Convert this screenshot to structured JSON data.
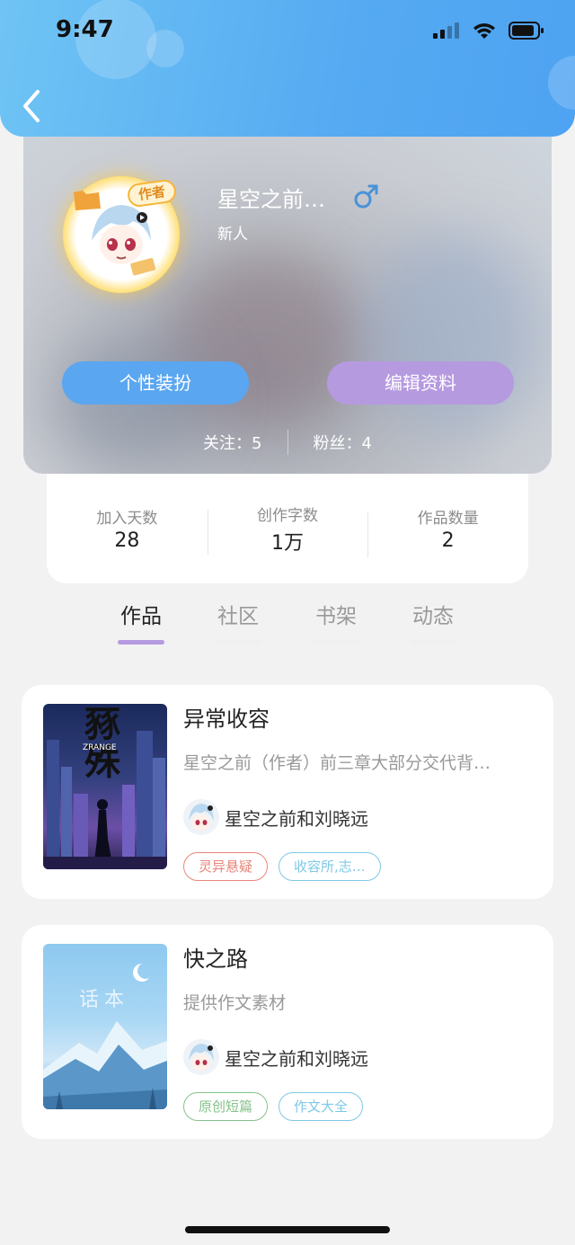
{
  "status_bar": {
    "time": "9:47"
  },
  "profile": {
    "nickname": "星空之前…",
    "level": "新人",
    "author_badge": "作者",
    "buttons": {
      "dress_up": "个性装扮",
      "edit_profile": "编辑资料"
    },
    "follow_label": "关注：",
    "follow_count": "5",
    "fans_label": "粉丝：",
    "fans_count": "4"
  },
  "stats": [
    {
      "label": "加入天数",
      "value": "28"
    },
    {
      "label": "创作字数",
      "value": "1万"
    },
    {
      "label": "作品数量",
      "value": "2"
    }
  ],
  "tabs": [
    {
      "label": "作品",
      "active": true
    },
    {
      "label": "社区",
      "active": false
    },
    {
      "label": "书架",
      "active": false
    },
    {
      "label": "动态",
      "active": false
    }
  ],
  "books": [
    {
      "title": "异常收容",
      "description": "星空之前（作者）前三章大部分交代背…",
      "author": "星空之前和刘晓远",
      "cover_text": "豩殊",
      "cover_subtext": "ZRANGE",
      "tags": [
        {
          "label": "灵异悬疑",
          "color": "#e8867a"
        },
        {
          "label": "收容所,志…",
          "color": "#7fc8e6"
        }
      ]
    },
    {
      "title": "快之路",
      "description": "提供作文素材",
      "author": "星空之前和刘晓远",
      "cover_text": "话本",
      "tags": [
        {
          "label": "原创短篇",
          "color": "#86c28a"
        },
        {
          "label": "作文大全",
          "color": "#7fc8e6"
        }
      ]
    }
  ],
  "colors": {
    "primary_blue": "#5aa6f0",
    "accent_purple": "#b59ae0",
    "header_gradient_start": "#6fc4f4",
    "header_gradient_end": "#4ea3f2"
  }
}
